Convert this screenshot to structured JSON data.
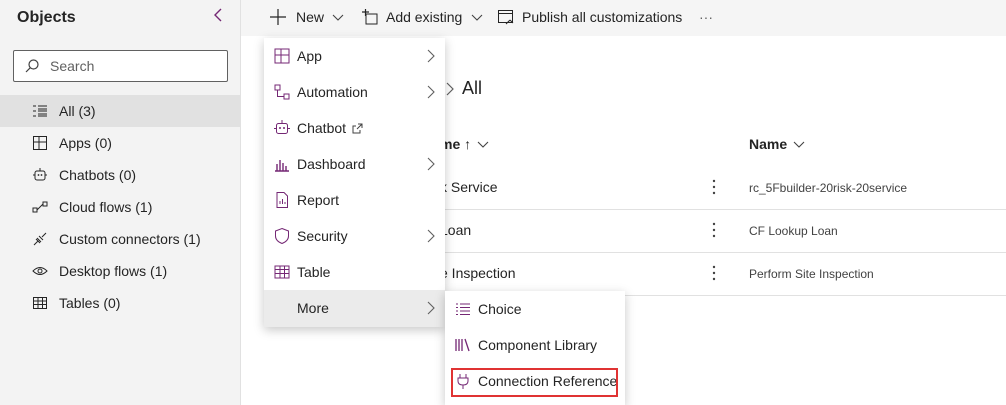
{
  "sidebar": {
    "title": "Objects",
    "search_placeholder": "Search",
    "items": [
      {
        "label": "All  (3)",
        "icon": "list-icon"
      },
      {
        "label": "Apps  (0)",
        "icon": "app-icon"
      },
      {
        "label": "Chatbots  (0)",
        "icon": "chatbot-icon"
      },
      {
        "label": "Cloud flows  (1)",
        "icon": "flow-icon"
      },
      {
        "label": "Custom connectors  (1)",
        "icon": "connector-icon"
      },
      {
        "label": "Desktop flows  (1)",
        "icon": "eye-icon"
      },
      {
        "label": "Tables  (0)",
        "icon": "table-icon"
      }
    ]
  },
  "toolbar": {
    "new_label": "New",
    "add_existing_label": "Add existing",
    "publish_label": "Publish all customizations",
    "more_label": "···"
  },
  "main": {
    "breadcrumb": "All",
    "col1_header": "me ↑",
    "col2_header": "Name",
    "rows": [
      {
        "display": "k Service",
        "name": "rc_5Fbuilder-20risk-20service"
      },
      {
        "display": "Loan",
        "name": "CF Lookup Loan"
      },
      {
        "display": "e Inspection",
        "name": "Perform Site Inspection"
      }
    ]
  },
  "new_menu": {
    "items": [
      {
        "label": "App",
        "icon": "app-icon",
        "submenu": true
      },
      {
        "label": "Automation",
        "icon": "automation-icon",
        "submenu": true
      },
      {
        "label": "Chatbot",
        "icon": "chatbot-icon",
        "submenu": false,
        "external": true
      },
      {
        "label": "Dashboard",
        "icon": "dashboard-icon",
        "submenu": true
      },
      {
        "label": "Report",
        "icon": "report-icon",
        "submenu": false
      },
      {
        "label": "Security",
        "icon": "shield-icon",
        "submenu": true
      },
      {
        "label": "Table",
        "icon": "table-icon",
        "submenu": false
      },
      {
        "label": "More",
        "icon": "",
        "submenu": true
      }
    ]
  },
  "more_menu": {
    "items": [
      {
        "label": "Choice",
        "icon": "choice-icon"
      },
      {
        "label": "Component Library",
        "icon": "library-icon"
      },
      {
        "label": "Connection Reference",
        "icon": "plug-icon"
      }
    ]
  },
  "colors": {
    "accent": "#742774",
    "highlight": "#e03333"
  }
}
